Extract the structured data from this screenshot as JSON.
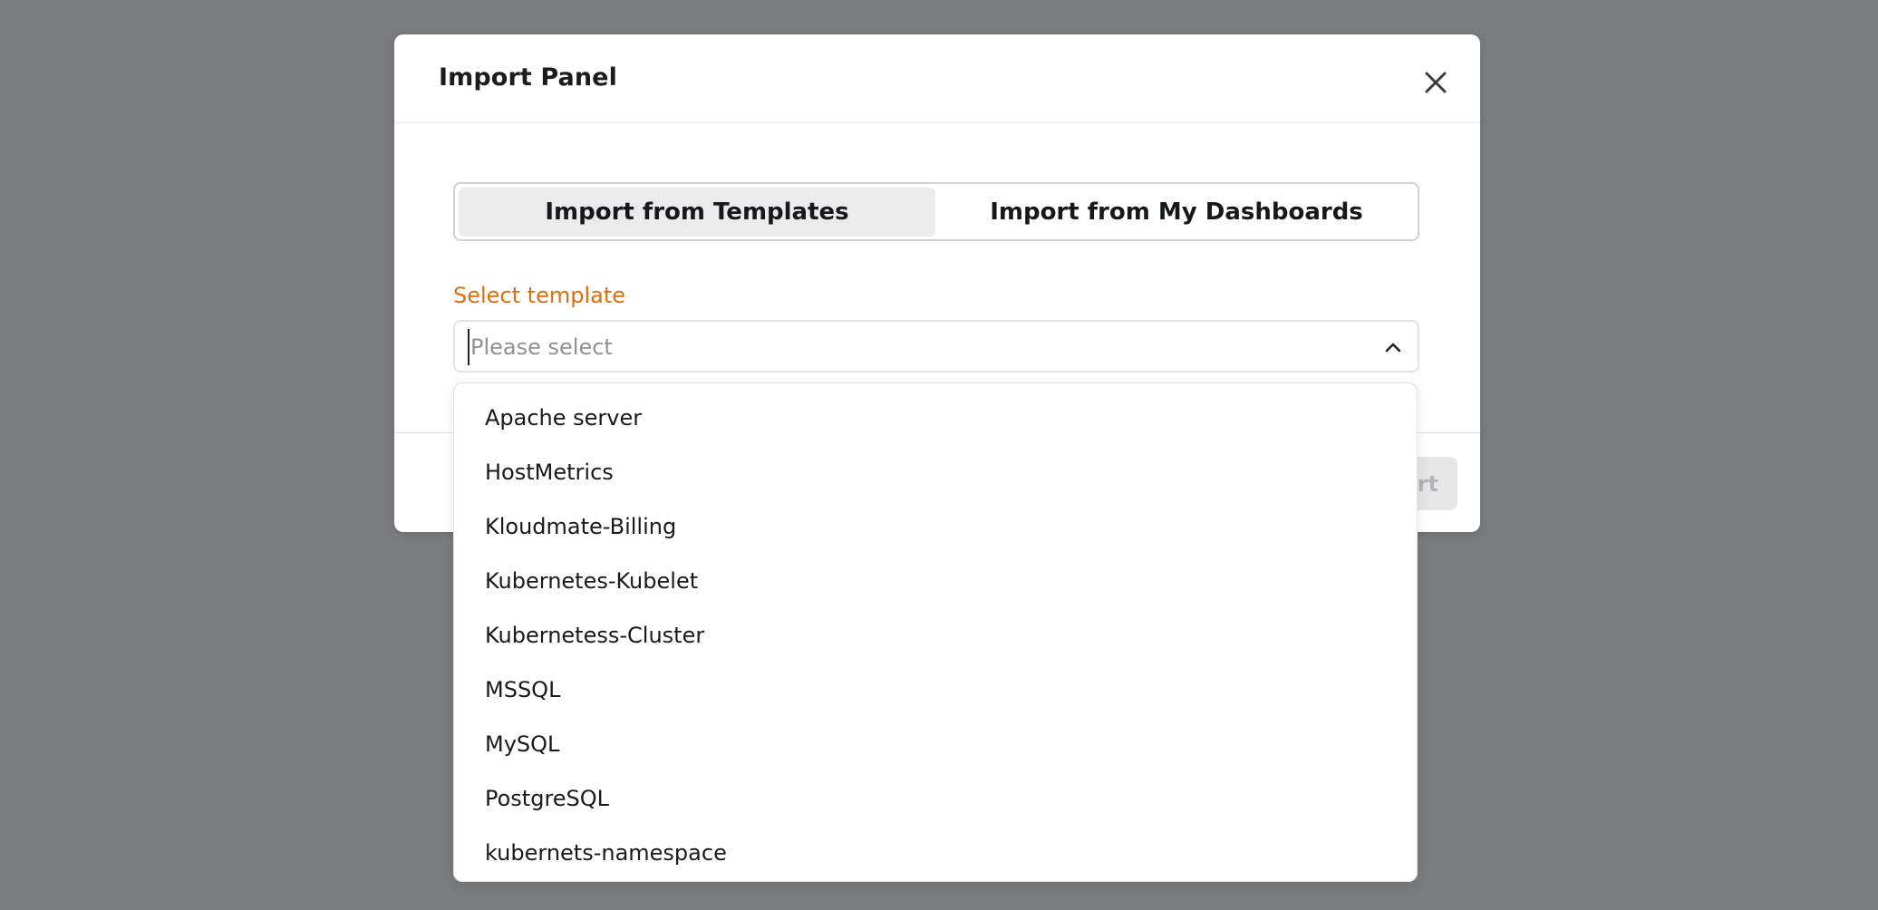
{
  "modal": {
    "title": "Import Panel",
    "close_icon": "close-icon"
  },
  "tabs": [
    {
      "label": "Import from Templates",
      "active": true
    },
    {
      "label": "Import from My Dashboards",
      "active": false
    }
  ],
  "template_field": {
    "label": "Select template",
    "placeholder": "Please select",
    "value": "",
    "toggle_icon": "chevron-up-icon"
  },
  "footer": {
    "import_label": "Import",
    "import_disabled": true
  },
  "dropdown": {
    "options": [
      "Apache server",
      "HostMetrics",
      "Kloudmate-Billing",
      "Kubernetes-Kubelet",
      "Kubernetess-Cluster",
      "MSSQL",
      "MySQL",
      "PostgreSQL",
      "kubernets-namespace"
    ]
  },
  "colors": {
    "backdrop": "#7b7c7e",
    "label_accent": "#d9700f",
    "active_tab_bg": "#ebebec"
  }
}
